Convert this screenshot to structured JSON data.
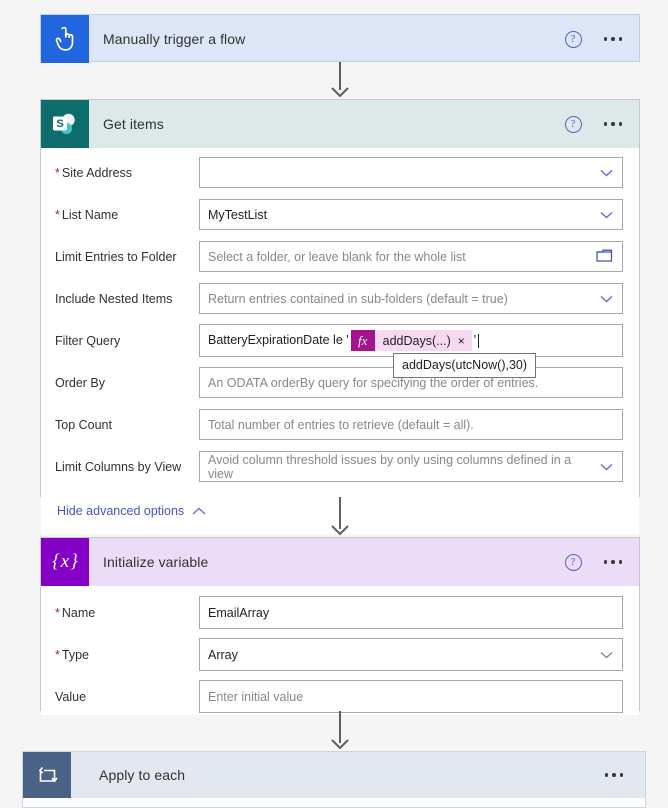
{
  "theme": {
    "page_bg": "#f5f5f5",
    "trigger_header_bg": "#dce6f7",
    "trigger_icon_bg": "#2266dd",
    "sharepoint_header_bg": "#dce9e8",
    "sharepoint_icon_bg": "#0d6c6c",
    "variable_header_bg": "#ebdcf7",
    "variable_icon_bg": "#8500c7",
    "loop_header_bg": "#e2e7f0",
    "loop_icon_bg": "#4a6285",
    "accent_link": "#4b53bc",
    "required_asterisk": "#a4262c",
    "token_fx_bg": "#a4138c",
    "token_body_bg": "#f6d9f0"
  },
  "cards": [
    {
      "id": "trigger",
      "title": "Manually trigger a flow",
      "icon": "manual-trigger-icon",
      "help_label": "?",
      "menu_label": "More commands"
    },
    {
      "id": "get-items",
      "title": "Get items",
      "icon": "sharepoint-icon",
      "help_label": "?",
      "menu_label": "More commands",
      "fields": [
        {
          "name": "site-address",
          "label": "Site Address",
          "required": true,
          "value": "",
          "placeholder": "",
          "control": "dropdown"
        },
        {
          "name": "list-name",
          "label": "List Name",
          "required": true,
          "value": "MyTestList",
          "placeholder": "",
          "control": "dropdown"
        },
        {
          "name": "limit-entries-to-folder",
          "label": "Limit Entries to Folder",
          "required": false,
          "value": "",
          "placeholder": "Select a folder, or leave blank for the whole list",
          "control": "folder-picker"
        },
        {
          "name": "include-nested-items",
          "label": "Include Nested Items",
          "required": false,
          "value": "",
          "placeholder": "Return entries contained in sub-folders (default = true)",
          "control": "dropdown"
        },
        {
          "name": "filter-query",
          "label": "Filter Query",
          "required": false,
          "control": "expression",
          "text_before": "BatteryExpirationDate le '",
          "token_label": "addDays(...)",
          "token_remove": "×",
          "token_badge": "fx",
          "text_after": "'",
          "tooltip": "addDays(utcNow(),30)"
        },
        {
          "name": "order-by",
          "label": "Order By",
          "required": false,
          "value": "",
          "placeholder": "An ODATA orderBy query for specifying the order of entries.",
          "control": "text"
        },
        {
          "name": "top-count",
          "label": "Top Count",
          "required": false,
          "value": "",
          "placeholder": "Total number of entries to retrieve (default = all).",
          "control": "text"
        },
        {
          "name": "limit-columns-by-view",
          "label": "Limit Columns by View",
          "required": false,
          "value": "",
          "placeholder": "Avoid column threshold issues by only using columns defined in a view",
          "control": "dropdown"
        }
      ],
      "advanced_link": "Hide advanced options"
    },
    {
      "id": "initialize-variable",
      "title": "Initialize variable",
      "icon": "variables-icon",
      "help_label": "?",
      "menu_label": "More commands",
      "fields": [
        {
          "name": "variable-name",
          "label": "Name",
          "required": true,
          "value": "EmailArray",
          "placeholder": "",
          "control": "text"
        },
        {
          "name": "variable-type",
          "label": "Type",
          "required": true,
          "value": "Array",
          "placeholder": "",
          "control": "dropdown"
        },
        {
          "name": "variable-value",
          "label": "Value",
          "required": false,
          "value": "",
          "placeholder": "Enter initial value",
          "control": "text"
        }
      ]
    },
    {
      "id": "apply-to-each",
      "title": "Apply to each",
      "icon": "loop-icon",
      "menu_label": "More commands"
    }
  ]
}
